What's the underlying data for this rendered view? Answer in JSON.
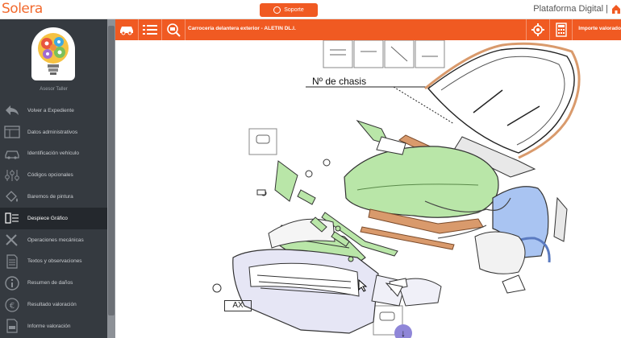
{
  "app": {
    "logo_text": "Solera",
    "support_label": "Soporte",
    "platform_label": "Plataforma Digital |"
  },
  "sidebar": {
    "advisor_name": "Asesor Taller",
    "items": [
      {
        "label": "Volver a Expediente",
        "icon": "back-arrow-icon"
      },
      {
        "label": "Datos administrativos",
        "icon": "admin-data-icon"
      },
      {
        "label": "Identificación vehículo",
        "icon": "car-icon"
      },
      {
        "label": "Códigos opcionales",
        "icon": "options-sliders-icon"
      },
      {
        "label": "Baremos de pintura",
        "icon": "paint-bucket-icon"
      },
      {
        "label": "Despiece Gráfico",
        "icon": "exploded-parts-icon",
        "active": true
      },
      {
        "label": "Operaciones mecánicas",
        "icon": "wrench-tools-icon"
      },
      {
        "label": "Textos y observaciones",
        "icon": "document-text-icon"
      },
      {
        "label": "Resumen de daños",
        "icon": "info-icon"
      },
      {
        "label": "Resultado valoración",
        "icon": "euro-icon"
      },
      {
        "label": "Informe valoración",
        "icon": "pdf-report-icon"
      }
    ]
  },
  "toolbar": {
    "title": "Carrocería delantera exterior - ALETIN DL.I.",
    "valuation_label": "Importe valorado"
  },
  "diagram": {
    "chassis_label": "Nº de chasis",
    "plate_label": "AX"
  },
  "colors": {
    "accent": "#f05a22",
    "sidebar_bg": "#353a40",
    "highlight_green": "#b9e6a8",
    "highlight_blue": "#a9c4f2",
    "highlight_orange": "#d99a6c"
  }
}
